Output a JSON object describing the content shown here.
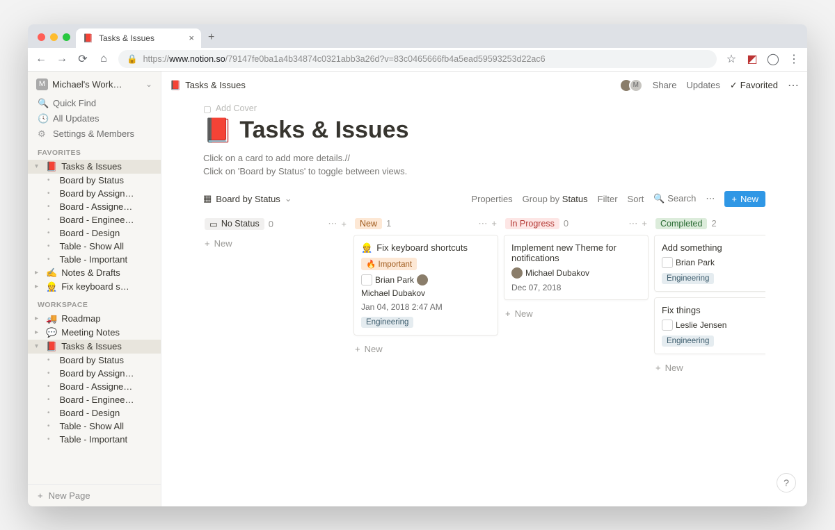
{
  "browser": {
    "tab_title": "Tasks & Issues",
    "url_host": "www.notion.so",
    "url_path": "/79147fe0ba1a4b34874c0321abb3a26d?v=83c0465666fb4a5ead59593253d22ac6"
  },
  "workspace": {
    "name": "Michael's Work…",
    "quick_find": "Quick Find",
    "all_updates": "All Updates",
    "settings": "Settings & Members",
    "new_page": "New Page"
  },
  "sections": {
    "favorites_label": "FAVORITES",
    "workspace_label": "WORKSPACE"
  },
  "favorites": [
    {
      "icon": "📕",
      "label": "Tasks & Issues",
      "selected": true
    },
    {
      "icon": "",
      "label": "Board by Status",
      "child": true
    },
    {
      "icon": "",
      "label": "Board by Assign…",
      "child": true
    },
    {
      "icon": "",
      "label": "Board - Assigne…",
      "child": true
    },
    {
      "icon": "",
      "label": "Board - Enginee…",
      "child": true
    },
    {
      "icon": "",
      "label": "Board - Design",
      "child": true
    },
    {
      "icon": "",
      "label": "Table - Show All",
      "child": true
    },
    {
      "icon": "",
      "label": "Table - Important",
      "child": true
    },
    {
      "icon": "✍️",
      "label": "Notes & Drafts"
    },
    {
      "icon": "👷",
      "label": "Fix keyboard s…"
    }
  ],
  "workspace_pages": [
    {
      "icon": "🚚",
      "label": "Roadmap"
    },
    {
      "icon": "💬",
      "label": "Meeting Notes"
    },
    {
      "icon": "📕",
      "label": "Tasks & Issues",
      "selected": true
    },
    {
      "icon": "",
      "label": "Board by Status",
      "child": true
    },
    {
      "icon": "",
      "label": "Board by Assign…",
      "child": true
    },
    {
      "icon": "",
      "label": "Board - Assigne…",
      "child": true
    },
    {
      "icon": "",
      "label": "Board - Enginee…",
      "child": true
    },
    {
      "icon": "",
      "label": "Board - Design",
      "child": true
    },
    {
      "icon": "",
      "label": "Table - Show All",
      "child": true
    },
    {
      "icon": "",
      "label": "Table - Important",
      "child": true
    }
  ],
  "header": {
    "breadcrumb_icon": "📕",
    "breadcrumb": "Tasks & Issues",
    "share": "Share",
    "updates": "Updates",
    "favorited": "Favorited"
  },
  "page": {
    "add_cover": "Add Cover",
    "icon": "📕",
    "title": "Tasks & Issues",
    "desc1": "Click on a card to add more details.//",
    "desc2": "Click on 'Board by Status' to toggle between views."
  },
  "viewbar": {
    "view_name": "Board by Status",
    "properties": "Properties",
    "groupby_label": "Group by",
    "groupby_value": "Status",
    "filter": "Filter",
    "sort": "Sort",
    "search": "Search",
    "new": "New"
  },
  "board": {
    "add_column": "Add",
    "columns": [
      {
        "id": "nostatus",
        "pill_class": "none",
        "name": "No Status",
        "count": "0",
        "cards": []
      },
      {
        "id": "new",
        "pill_class": "new",
        "name": "New",
        "count": "1",
        "cards": [
          {
            "icon": "👷",
            "title": "Fix keyboard shortcuts",
            "tag_important": "🔥 Important",
            "people": [
              {
                "cls": "bp",
                "name": "Brian Park"
              },
              {
                "cls": "md",
                "name": "Michael Dubakov"
              }
            ],
            "date": "Jan 04, 2018 2:47 AM",
            "tag_eng": "Engineering"
          }
        ]
      },
      {
        "id": "inprogress",
        "pill_class": "prog",
        "name": "In Progress",
        "count": "0",
        "cards": [
          {
            "title": "Implement new Theme for notifications",
            "people": [
              {
                "cls": "md",
                "name": "Michael Dubakov"
              }
            ],
            "date": "Dec 07, 2018"
          }
        ]
      },
      {
        "id": "completed",
        "pill_class": "done",
        "name": "Completed",
        "count": "2",
        "cards": [
          {
            "title": "Add something",
            "people": [
              {
                "cls": "bp",
                "name": "Brian Park"
              }
            ],
            "tag_eng": "Engineering"
          },
          {
            "title": "Fix things",
            "people": [
              {
                "cls": "bp",
                "name": "Leslie Jensen"
              }
            ],
            "tag_eng": "Engineering"
          }
        ]
      }
    ],
    "new_row": "New"
  }
}
